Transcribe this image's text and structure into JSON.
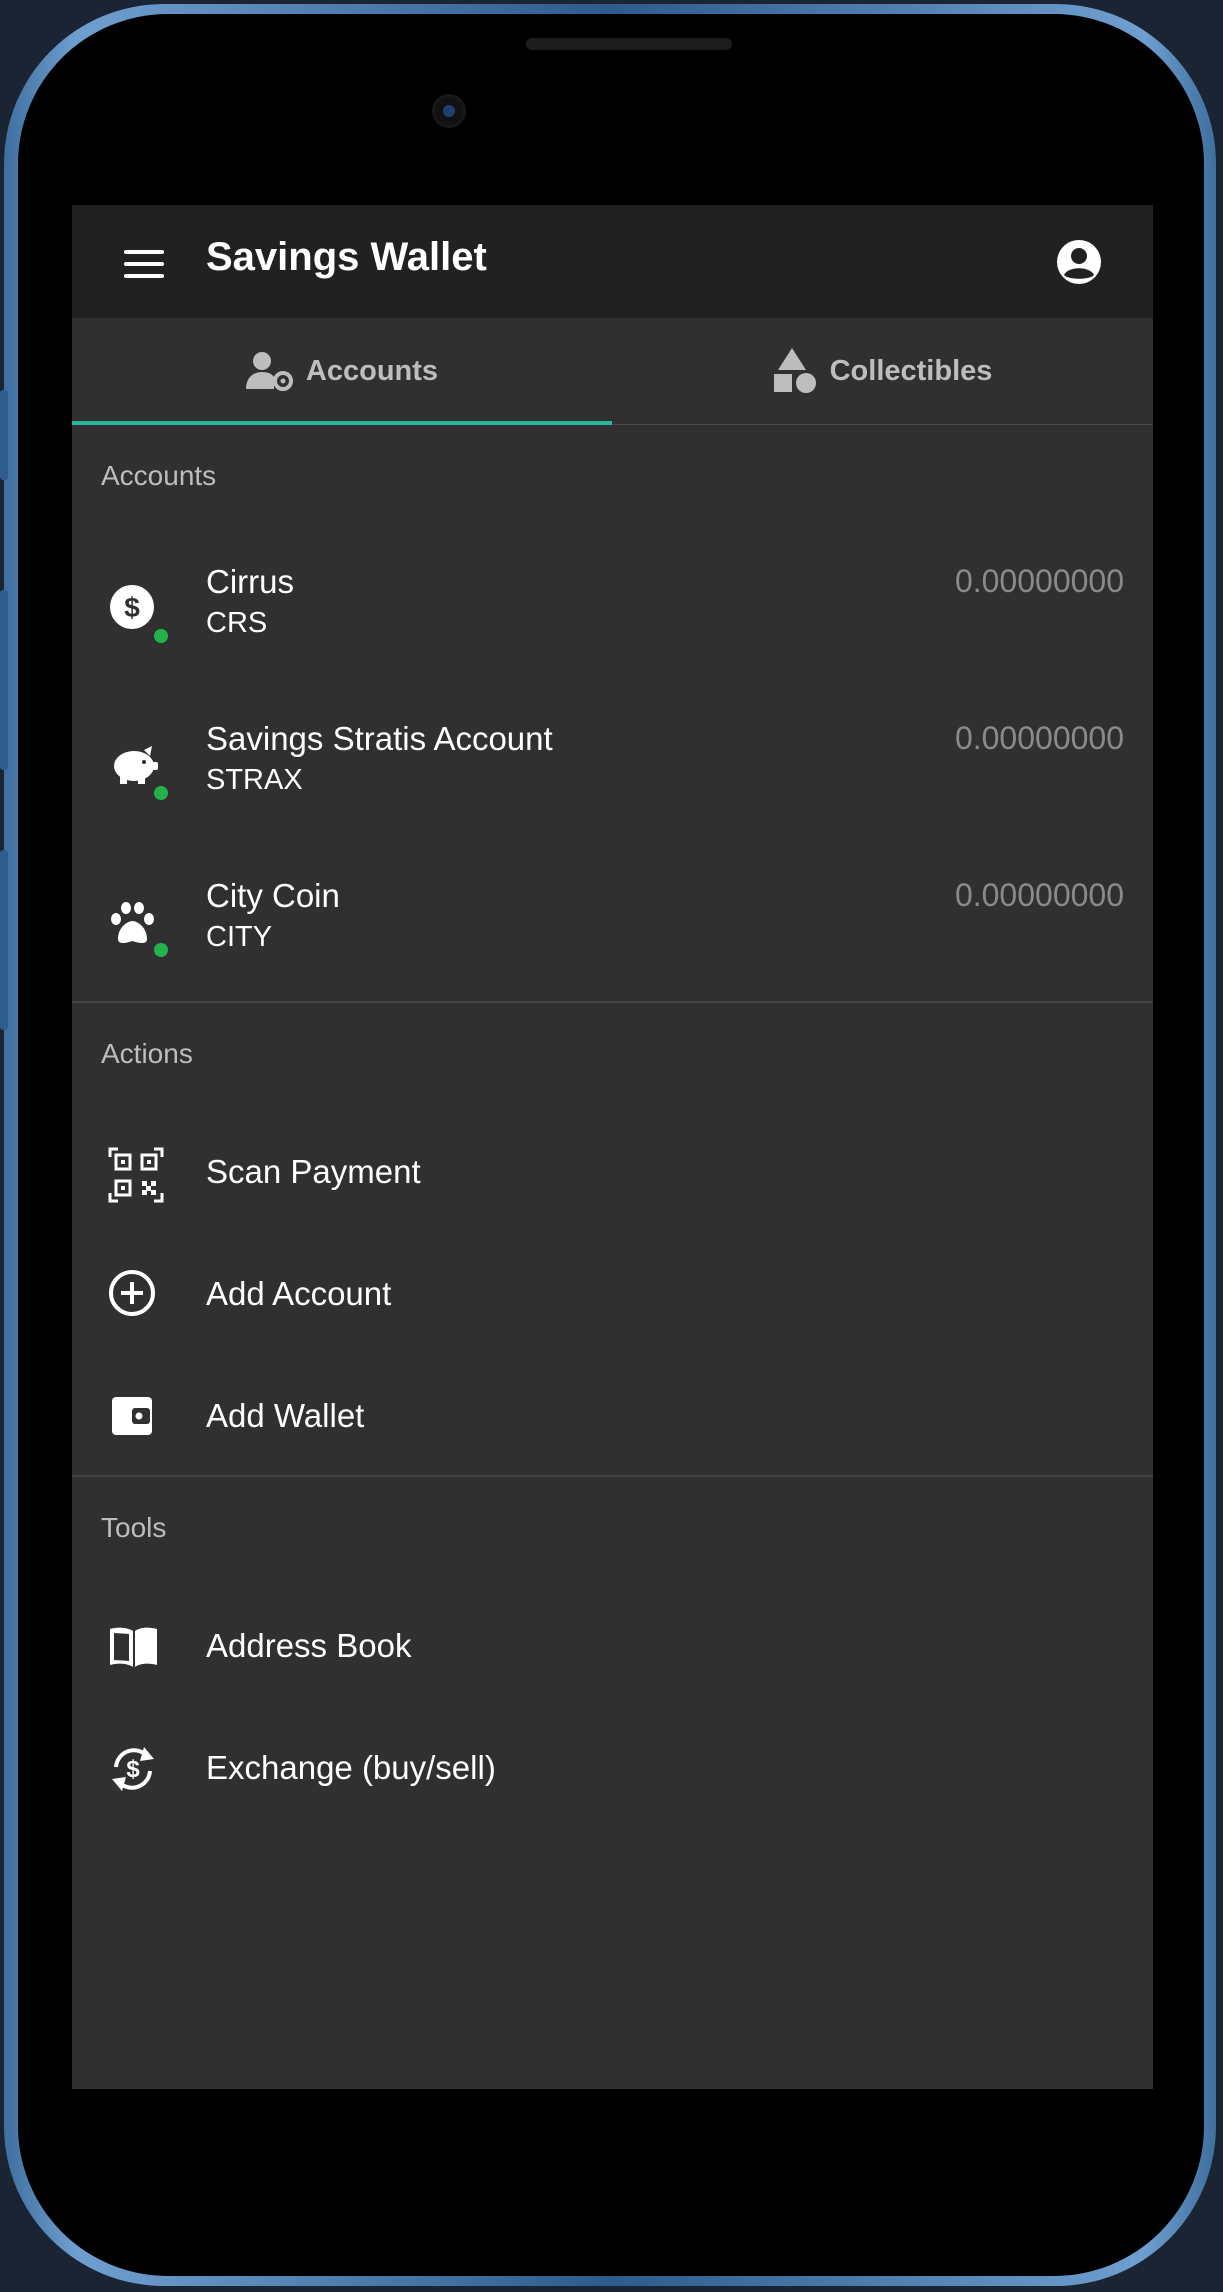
{
  "app": {
    "title": "Savings Wallet"
  },
  "icons": {
    "menu": "hamburger-menu-icon",
    "profile": "account-circle-icon",
    "tab_accounts": "users-gear-icon",
    "tab_collectibles": "shapes-icon"
  },
  "tabs": [
    {
      "label": "Accounts",
      "active": true
    },
    {
      "label": "Collectibles",
      "active": false
    }
  ],
  "accent_color": "#2ab69f",
  "status_color": "#22b24c",
  "sections": {
    "accounts": "Accounts",
    "actions": "Actions",
    "tools": "Tools"
  },
  "accounts": [
    {
      "name": "Cirrus",
      "symbol": "CRS",
      "balance": "0.00000000",
      "icon": "dollar-circle-icon"
    },
    {
      "name": "Savings Stratis Account",
      "symbol": "STRAX",
      "balance": "0.00000000",
      "icon": "piggy-bank-icon"
    },
    {
      "name": "City Coin",
      "symbol": "CITY",
      "balance": "0.00000000",
      "icon": "paw-icon"
    }
  ],
  "actions": [
    {
      "label": "Scan Payment",
      "icon": "qr-code-icon"
    },
    {
      "label": "Add Account",
      "icon": "plus-circle-icon"
    },
    {
      "label": "Add Wallet",
      "icon": "wallet-icon"
    }
  ],
  "tools": [
    {
      "label": "Address Book",
      "icon": "book-open-icon"
    },
    {
      "label": "Exchange (buy/sell)",
      "icon": "exchange-dollar-icon"
    }
  ]
}
